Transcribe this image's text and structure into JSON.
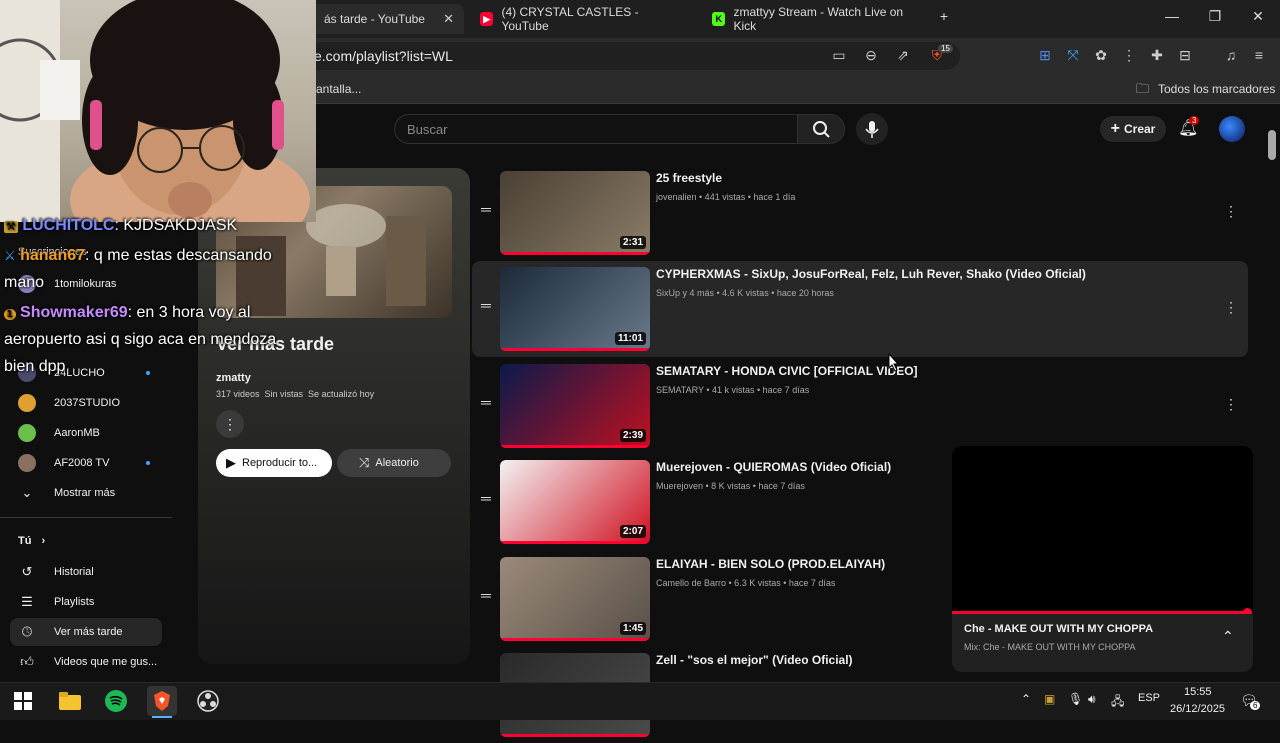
{
  "browser": {
    "tabs": [
      {
        "title": "ás tarde - YouTube",
        "active": true
      },
      {
        "title": "(4) CRYSTAL CASTLES - YouTube",
        "active": false
      },
      {
        "title": "zmattyy Stream - Watch Live on Kick",
        "active": false
      }
    ],
    "new_tab": "+",
    "url": "e.com/playlist?list=WL",
    "bookmark_partial": "antalla...",
    "all_bookmarks": "Todos los marcadores",
    "brave_badge": "15"
  },
  "youtube": {
    "search_placeholder": "Buscar",
    "create_label": "Crear",
    "notif_count": "3"
  },
  "sidebar": {
    "subs": [
      {
        "name": "1tomilokuras",
        "color": "#8a7fb8",
        "live": false
      },
      {
        "name": "24LUCHO",
        "color": "#4a4a6a",
        "live": true
      },
      {
        "name": "2037STUDIO",
        "color": "#e0a030",
        "live": false
      },
      {
        "name": "AaronMB",
        "color": "#6ac04a",
        "live": false
      },
      {
        "name": "AF2008 TV",
        "color": "#8a7060",
        "live": true
      }
    ],
    "subs_label": "Suscripciones",
    "show_more": "Mostrar más",
    "you_label": "Tú",
    "you_items": [
      {
        "label": "Historial",
        "icon": "history"
      },
      {
        "label": "Playlists",
        "icon": "playlists"
      },
      {
        "label": "Ver más tarde",
        "icon": "clock",
        "active": true
      },
      {
        "label": "Videos que me gus...",
        "icon": "thumbs-up"
      }
    ]
  },
  "playlist": {
    "title": "Ver más tarde",
    "owner": "zmatty",
    "stats": "317 videos  Sin vistas  Se actualizó hoy",
    "play_label": "Reproducir to...",
    "shuffle_label": "Aleatorio"
  },
  "videos": [
    {
      "title": "25 freestyle",
      "meta": "jovenalien • 441 vistas • hace 1 día",
      "duration": "2:31",
      "thumb": [
        "#4a4034",
        "#8a7c68"
      ]
    },
    {
      "title": "CYPHERXMAS - SixUp, JosuForReal, Felz, Luh Rever, Shako (Video Oficial)",
      "meta": "SixUp y 4 más • 4.6 K vistas • hace 20 horas",
      "duration": "11:01",
      "thumb": [
        "#1c2a3a",
        "#6a7a8a"
      ]
    },
    {
      "title": "SEMATARY - HONDA CIVIC [OFFICIAL VIDEO]",
      "meta": "SEMATARY • 41 k vistas • hace 7 días",
      "duration": "2:39",
      "thumb": [
        "#0a1a4a",
        "#c01020"
      ]
    },
    {
      "title": "Muerejoven - QUIEROMAS (Video Oficial)",
      "meta": "Muerejoven • 8 K vistas • hace 7 días",
      "duration": "2:07",
      "thumb": [
        "#f2f2f2",
        "#d01020"
      ]
    },
    {
      "title": "ELAIYAH - BIEN SOLO (PROD.ELAIYAH)",
      "meta": "Camello de Barro • 6.3 K vistas • hace 7 días",
      "duration": "1:45",
      "thumb": [
        "#9a8a7a",
        "#5a5048"
      ]
    },
    {
      "title": "Zell - \"sos el mejor\" (Video Oficial)",
      "meta": "",
      "duration": "",
      "thumb": [
        "#2a2a2a",
        "#4a4a4a"
      ]
    }
  ],
  "miniplayer": {
    "title": "Che - MAKE OUT WITH MY CHOPPA",
    "subtitle": "Mix: Che - MAKE OUT WITH MY CHOPPA"
  },
  "chat": [
    {
      "badge": "moderator",
      "user": "LUCHITOLC",
      "message": ": KJDSAKDJASK"
    },
    {
      "badge": "sword",
      "user": "hanan67",
      "message": ": q me estas descansando"
    },
    {
      "badge": "",
      "user": "",
      "message": "mano"
    },
    {
      "badge": "gift",
      "user": "Showmaker69",
      "message": ": en 3 hora voy al"
    },
    {
      "badge": "",
      "user": "",
      "message": "aeropuerto asi q sigo aca en mendoza"
    },
    {
      "badge": "",
      "user": "",
      "message": "bien dpp"
    }
  ],
  "taskbar": {
    "lang": "ESP",
    "time": "15:55",
    "date": "26/12/2025",
    "notif_count": "6"
  }
}
